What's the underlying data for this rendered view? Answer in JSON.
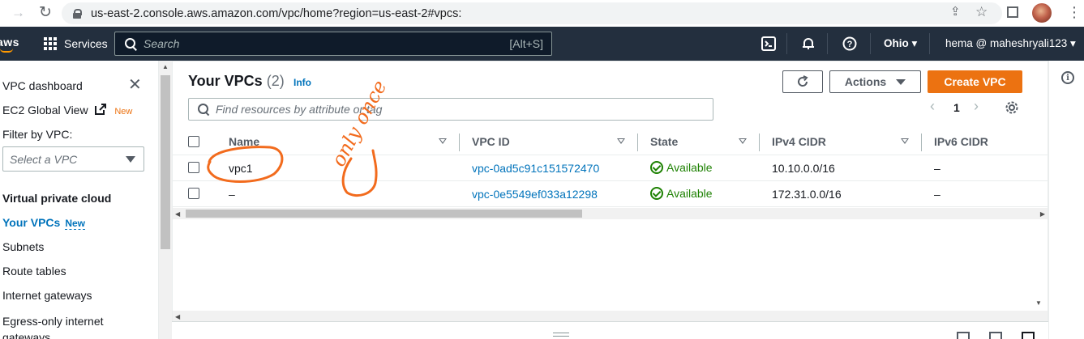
{
  "browser": {
    "url": "us-east-2.console.aws.amazon.com/vpc/home?region=us-east-2#vpcs:"
  },
  "aws_nav": {
    "logo": "aws",
    "services_label": "Services",
    "search_placeholder": "Search",
    "search_shortcut": "[Alt+S]",
    "region": "Ohio",
    "account": "hema @ maheshryali123"
  },
  "sidebar": {
    "dashboard": "VPC dashboard",
    "ec2_global_view": "EC2 Global View",
    "ec2_badge": "New",
    "filter_label": "Filter by VPC:",
    "select_placeholder": "Select a VPC",
    "section_title": "Virtual private cloud",
    "items": [
      {
        "label": "Your VPCs",
        "badge": "New"
      },
      {
        "label": "Subnets"
      },
      {
        "label": "Route tables"
      },
      {
        "label": "Internet gateways"
      },
      {
        "label": "Egress-only internet gateways"
      }
    ]
  },
  "panel": {
    "title": "Your VPCs",
    "count": "(2)",
    "info": "Info",
    "actions_label": "Actions",
    "create_label": "Create VPC",
    "filter_placeholder": "Find resources by attribute or tag",
    "page": "1"
  },
  "table": {
    "columns": [
      "Name",
      "VPC ID",
      "State",
      "IPv4 CIDR",
      "IPv6 CIDR"
    ],
    "rows": [
      {
        "name": "vpc1",
        "vpc_id": "vpc-0ad5c91c151572470",
        "state": "Available",
        "ipv4": "10.10.0.0/16",
        "ipv6": "–"
      },
      {
        "name": "–",
        "vpc_id": "vpc-0e5549ef033a12298",
        "state": "Available",
        "ipv4": "172.31.0.0/16",
        "ipv6": "–"
      }
    ]
  },
  "annotation": {
    "text": "only once",
    "color": "#f26b1d"
  }
}
